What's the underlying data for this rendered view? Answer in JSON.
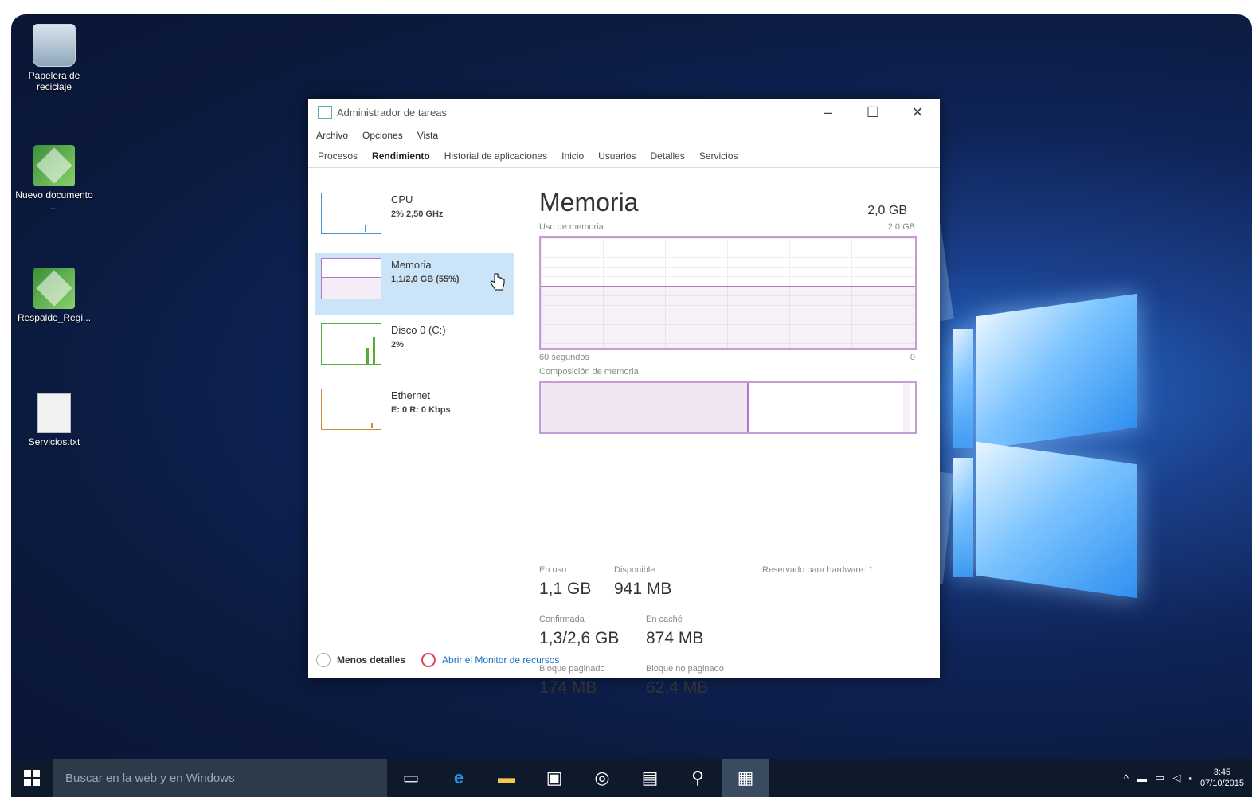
{
  "desktop": {
    "icons": [
      {
        "label": "Papelera de reciclaje",
        "icon": "recycle-bin-icon"
      },
      {
        "label": "Nuevo documento ...",
        "icon": "document-icon"
      },
      {
        "label": "Respaldo_Regi...",
        "icon": "document-icon"
      },
      {
        "label": "Servicios.txt",
        "icon": "text-file-icon"
      }
    ]
  },
  "window": {
    "title": "Administrador de tareas",
    "controls": {
      "minimize": "–",
      "maximize": "☐",
      "close": "✕"
    },
    "menu": [
      "Archivo",
      "Opciones",
      "Vista"
    ],
    "tabs": [
      "Procesos",
      "Rendimiento",
      "Historial de aplicaciones",
      "Inicio",
      "Usuarios",
      "Detalles",
      "Servicios"
    ],
    "active_tab": "Rendimiento",
    "resources": [
      {
        "name": "CPU",
        "detail": "2% 2,50 GHz",
        "color": "#4a90c9"
      },
      {
        "name": "Memoria",
        "detail": "1,1/2,0 GB (55%)",
        "color": "#b477c7"
      },
      {
        "name": "Disco 0 (C:)",
        "detail": "2%",
        "color": "#5aaa3a"
      },
      {
        "name": "Ethernet",
        "detail": "E: 0 R: 0 Kbps",
        "color": "#d08a3a"
      }
    ],
    "memory": {
      "title": "Memoria",
      "total": "2,0 GB",
      "usage_label": "Uso de memoria",
      "usage_max": "2,0 GB",
      "time_label": "60 segundos",
      "time_end": "0",
      "composition_label": "Composición de memoria",
      "usage_fraction": 0.55,
      "composition_in_use_fraction": 0.55,
      "stats": {
        "in_use_label": "En uso",
        "in_use": "1,1 GB",
        "available_label": "Disponible",
        "available": "941 MB",
        "hardware_reserved_label": "Reservado para hardware:",
        "hardware_reserved": "1",
        "committed_label": "Confirmada",
        "committed": "1,3/2,6 GB",
        "cached_label": "En caché",
        "cached": "874 MB",
        "paged_label": "Bloque paginado",
        "paged": "174 MB",
        "nonpaged_label": "Bloque no paginado",
        "nonpaged": "62,4 MB"
      }
    },
    "footer": {
      "less_details": "Menos detalles",
      "resource_monitor": "Abrir el Monitor de recursos"
    }
  },
  "taskbar": {
    "search_placeholder": "Buscar en la web y en Windows",
    "clock_time": "3:45",
    "clock_date": "07/10/2015"
  }
}
